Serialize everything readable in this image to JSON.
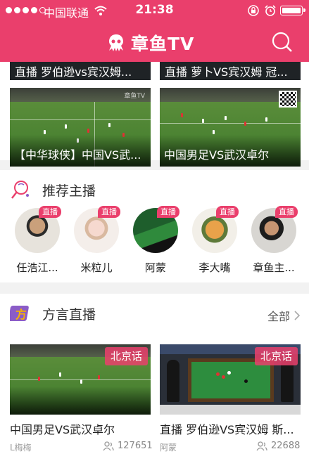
{
  "status_bar": {
    "carrier": "中国联通",
    "time": "21:38"
  },
  "header": {
    "logo_text": "章鱼TV"
  },
  "top_strips": [
    {
      "title": "直播 罗伯逊vs宾汉姆..."
    },
    {
      "title": "直播 萝卜VS宾汉姆 冠..."
    }
  ],
  "videos": [
    {
      "caption": "【中华球侠】中国VS武..."
    },
    {
      "caption": "中国男足VS武汉卓尔"
    }
  ],
  "recommended": {
    "title": "推荐主播",
    "badge_label": "直播",
    "anchors": [
      {
        "name": "任浩江..."
      },
      {
        "name": "米粒儿"
      },
      {
        "name": "阿蒙"
      },
      {
        "name": "李大嘴"
      },
      {
        "name": "章鱼主..."
      }
    ]
  },
  "dialect": {
    "title": "方言直播",
    "more_label": "全部",
    "cards": [
      {
        "tag": "北京话",
        "title": "中国男足VS武汉卓尔",
        "streamer": "L梅梅",
        "viewers": "127651"
      },
      {
        "tag": "北京话",
        "title": "直播 罗伯逊VS宾汉姆 斯...",
        "streamer": "阿蒙",
        "viewers": "22688"
      }
    ]
  },
  "colors": {
    "brand": "#ea3f6c",
    "page_bg": "#f2f2f2"
  },
  "icons": [
    "wifi-icon",
    "lock-icon",
    "alarm-icon",
    "battery-icon",
    "octopus-logo-icon",
    "search-icon",
    "microphone-icon",
    "dialect-icon",
    "chevron-right-icon",
    "viewers-icon"
  ]
}
